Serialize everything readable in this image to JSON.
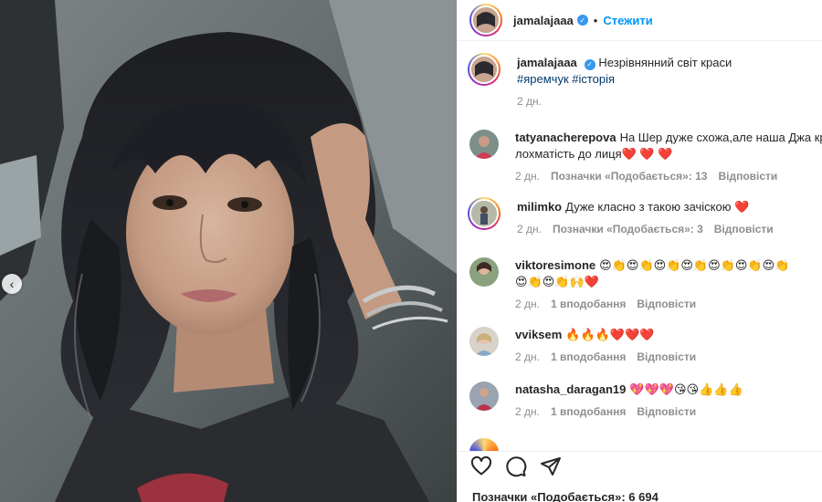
{
  "post": {
    "author": "jamalajaaa",
    "follow_label": "Стежити",
    "separator": "•",
    "caption": "Незрівнянний світ краси",
    "hashtags": "#яремчук #історія",
    "caption_time": "2 дн.",
    "likes": "Позначки «Подобається»: 6 694"
  },
  "comments": [
    {
      "user": "tatyanacherepova",
      "text": "На Шер дуже схожа,але наша Джа кра",
      "text2": "лохматість до лиця❤️ ❤️ ❤️",
      "time": "2 дн.",
      "likes": "Позначки «Подобається»: 13",
      "reply": "Відповісти"
    },
    {
      "user": "milimko",
      "text": "Дуже класно з такою зачіскою ❤️",
      "time": "2 дн.",
      "likes": "Позначки «Подобається»: 3",
      "reply": "Відповісти"
    },
    {
      "user": "viktoresimone",
      "text": "😍👏😍👏😍👏😍👏😍👏😍👏😍👏",
      "text2": "😍👏😍👏🙌❤️",
      "time": "2 дн.",
      "likes": "1 вподобання",
      "reply": "Відповісти"
    },
    {
      "user": "vviksem",
      "text": "🔥🔥🔥❤️❤️❤️",
      "time": "2 дн.",
      "likes": "1 вподобання",
      "reply": "Відповісти"
    },
    {
      "user": "natasha_daragan19",
      "text": "💖💖💖😘😘👍👍👍",
      "time": "2 дн.",
      "likes": "1 вподобання",
      "reply": "Відповісти"
    }
  ],
  "icons": {
    "prev": "chevron-left-icon",
    "like": "heart-icon",
    "comment": "comment-icon",
    "share": "send-icon",
    "verified": "verified-badge-icon"
  },
  "colors": {
    "link": "#0095f6",
    "hashtag": "#00376b",
    "muted": "#8e8e8e",
    "verified": "#3897f0"
  }
}
